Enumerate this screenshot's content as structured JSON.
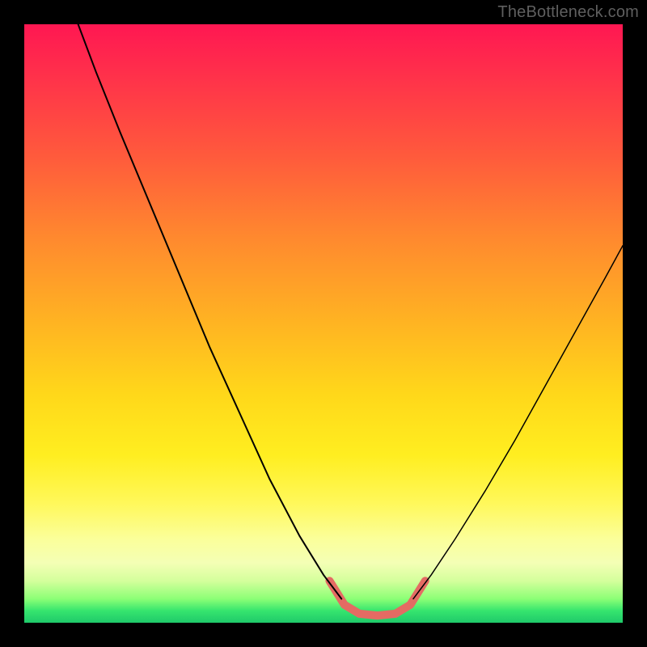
{
  "watermark": "TheBottleneck.com",
  "chart_data": {
    "type": "line",
    "title": "",
    "xlabel": "",
    "ylabel": "",
    "x_range": [
      0,
      100
    ],
    "y_range": [
      0,
      100
    ],
    "gradient_stops": [
      {
        "pos": 0,
        "color": "#ff1752"
      },
      {
        "pos": 8,
        "color": "#ff2f4b"
      },
      {
        "pos": 22,
        "color": "#ff5a3c"
      },
      {
        "pos": 36,
        "color": "#ff8a2e"
      },
      {
        "pos": 50,
        "color": "#ffb422"
      },
      {
        "pos": 62,
        "color": "#ffd81a"
      },
      {
        "pos": 72,
        "color": "#ffee20"
      },
      {
        "pos": 80,
        "color": "#fff85a"
      },
      {
        "pos": 86,
        "color": "#fbff9a"
      },
      {
        "pos": 90,
        "color": "#f4ffb5"
      },
      {
        "pos": 93,
        "color": "#d4ff9c"
      },
      {
        "pos": 96,
        "color": "#8cff76"
      },
      {
        "pos": 98,
        "color": "#36e56e"
      },
      {
        "pos": 100,
        "color": "#1fc96a"
      }
    ],
    "series": [
      {
        "name": "left-curve",
        "stroke": "#000000",
        "stroke_width": 2,
        "points": [
          {
            "x": 9.0,
            "y": 100.0
          },
          {
            "x": 12.0,
            "y": 92.0
          },
          {
            "x": 16.0,
            "y": 82.0
          },
          {
            "x": 21.0,
            "y": 70.0
          },
          {
            "x": 26.0,
            "y": 58.0
          },
          {
            "x": 31.0,
            "y": 46.0
          },
          {
            "x": 36.0,
            "y": 35.0
          },
          {
            "x": 41.0,
            "y": 24.0
          },
          {
            "x": 46.0,
            "y": 14.5
          },
          {
            "x": 50.0,
            "y": 8.0
          },
          {
            "x": 53.0,
            "y": 4.0
          }
        ]
      },
      {
        "name": "right-curve",
        "stroke": "#000000",
        "stroke_width": 1.5,
        "points": [
          {
            "x": 65.0,
            "y": 4.0
          },
          {
            "x": 68.0,
            "y": 8.0
          },
          {
            "x": 72.0,
            "y": 14.0
          },
          {
            "x": 77.0,
            "y": 22.0
          },
          {
            "x": 82.0,
            "y": 30.5
          },
          {
            "x": 87.0,
            "y": 39.5
          },
          {
            "x": 92.0,
            "y": 48.5
          },
          {
            "x": 97.0,
            "y": 57.5
          },
          {
            "x": 100.0,
            "y": 63.0
          }
        ]
      },
      {
        "name": "valley-highlight",
        "stroke": "#e46b63",
        "stroke_width": 10,
        "linecap": "round",
        "points": [
          {
            "x": 51.0,
            "y": 7.0
          },
          {
            "x": 53.5,
            "y": 3.0
          },
          {
            "x": 56.0,
            "y": 1.5
          },
          {
            "x": 59.0,
            "y": 1.2
          },
          {
            "x": 62.0,
            "y": 1.5
          },
          {
            "x": 64.5,
            "y": 3.0
          },
          {
            "x": 67.0,
            "y": 7.0
          }
        ]
      }
    ]
  }
}
